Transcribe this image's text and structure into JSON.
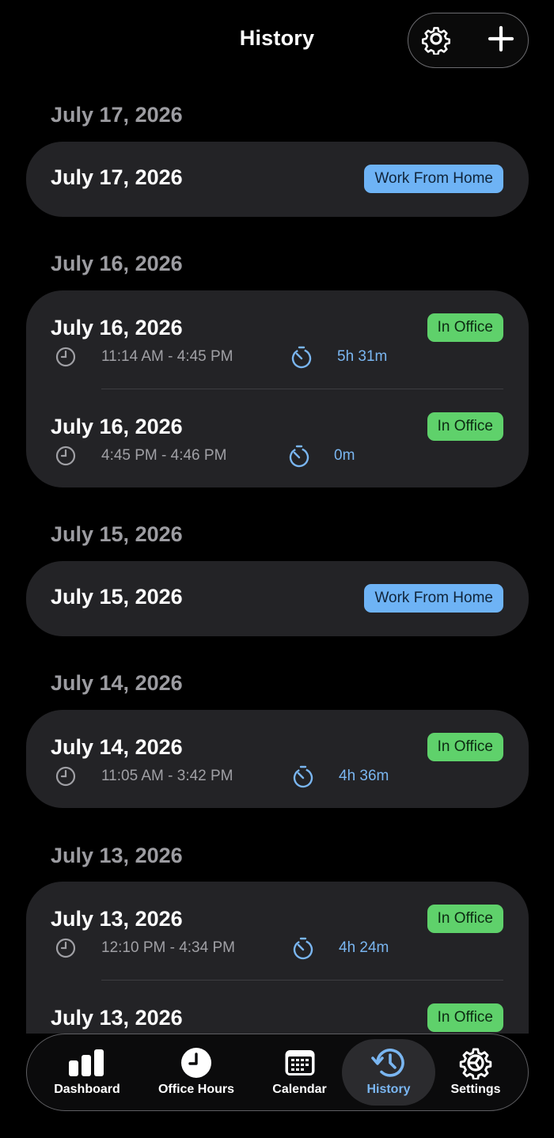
{
  "header": {
    "title": "History"
  },
  "sections": [
    {
      "label": "July 17, 2026",
      "entries": [
        {
          "date": "July 17, 2026",
          "status": "Work From Home"
        }
      ]
    },
    {
      "label": "July 16, 2026",
      "entries": [
        {
          "date": "July 16, 2026",
          "status": "In Office",
          "time_range": "11:14 AM - 4:45 PM",
          "duration": "5h 31m"
        },
        {
          "date": "July 16, 2026",
          "status": "In Office",
          "time_range": "4:45 PM - 4:46 PM",
          "duration": "0m"
        }
      ]
    },
    {
      "label": "July 15, 2026",
      "entries": [
        {
          "date": "July 15, 2026",
          "status": "Work From Home"
        }
      ]
    },
    {
      "label": "July 14, 2026",
      "entries": [
        {
          "date": "July 14, 2026",
          "status": "In Office",
          "time_range": "11:05 AM - 3:42 PM",
          "duration": "4h 36m"
        }
      ]
    },
    {
      "label": "July 13, 2026",
      "entries": [
        {
          "date": "July 13, 2026",
          "status": "In Office",
          "time_range": "12:10 PM - 4:34 PM",
          "duration": "4h 24m"
        },
        {
          "date": "July 13, 2026",
          "status": "In Office"
        }
      ]
    }
  ],
  "tabbar": {
    "items": [
      {
        "label": "Dashboard",
        "icon": "bar-chart-icon"
      },
      {
        "label": "Office Hours",
        "icon": "clock-icon"
      },
      {
        "label": "Calendar",
        "icon": "calendar-icon"
      },
      {
        "label": "History",
        "icon": "history-icon",
        "active": true
      },
      {
        "label": "Settings",
        "icon": "settings-icon"
      }
    ]
  },
  "colors": {
    "background": "#000000",
    "card": "#232326",
    "wfh_badge": "#6eb3f5",
    "office_badge": "#5fd16b",
    "accent": "#7ab6f1",
    "muted_text": "#9c9ca1"
  }
}
